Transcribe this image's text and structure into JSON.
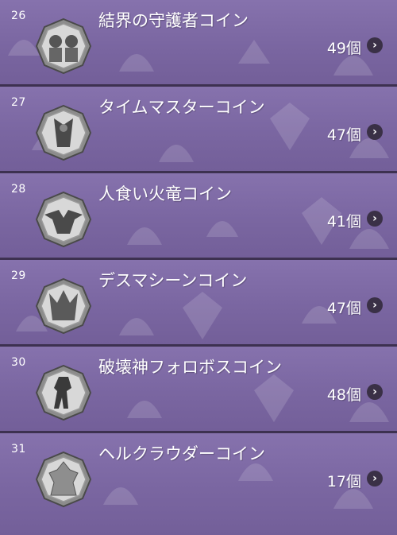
{
  "coins": [
    {
      "index": "26",
      "name": "結界の守護者コイン",
      "count": "49個",
      "icon": "barrier-guardian-coin-icon"
    },
    {
      "index": "27",
      "name": "タイムマスターコイン",
      "count": "47個",
      "icon": "time-master-coin-icon"
    },
    {
      "index": "28",
      "name": "人食い火竜コイン",
      "count": "41個",
      "icon": "man-eating-fire-dragon-coin-icon"
    },
    {
      "index": "29",
      "name": "デスマシーンコイン",
      "count": "47個",
      "icon": "death-machine-coin-icon"
    },
    {
      "index": "30",
      "name": "破壊神フォロボスコイン",
      "count": "48個",
      "icon": "destruction-god-forobos-coin-icon"
    },
    {
      "index": "31",
      "name": "ヘルクラウダーコイン",
      "count": "17個",
      "icon": "hell-clouder-coin-icon"
    }
  ],
  "colors": {
    "row_bg": "#7b67a2",
    "divider": "#3d3150",
    "text": "#ffffff",
    "chevron_bg": "#3a3046"
  },
  "chevron_glyph": "›"
}
